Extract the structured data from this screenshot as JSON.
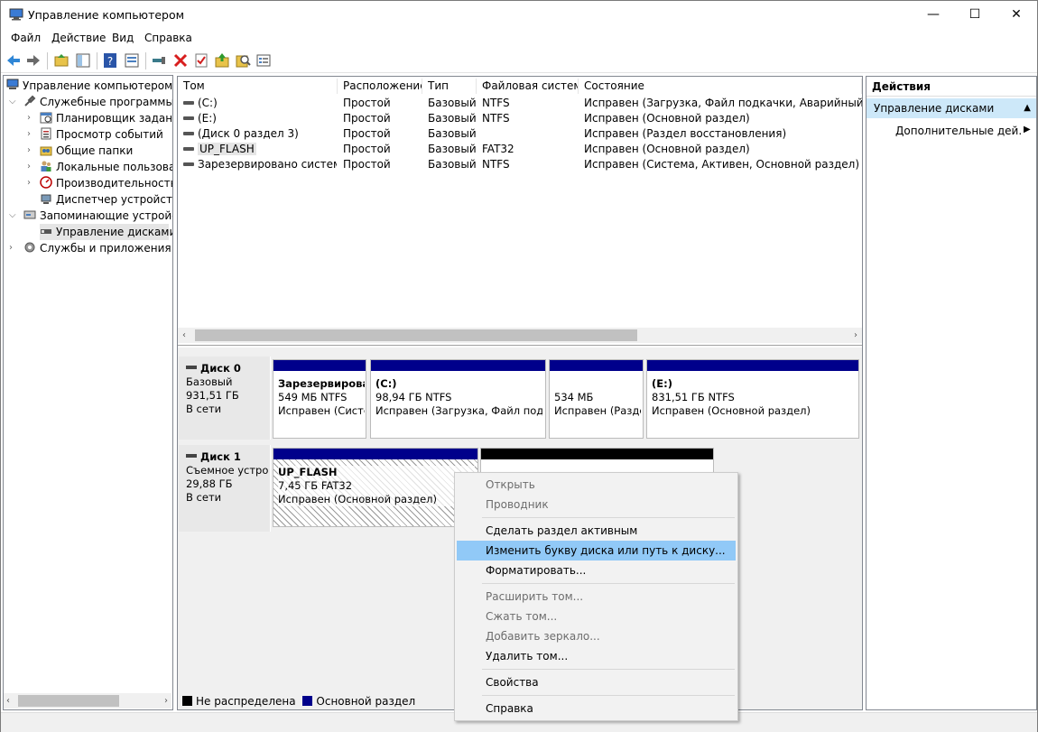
{
  "window": {
    "title": "Управление компьютером",
    "controls": {
      "minimize": "—",
      "maximize": "☐",
      "close": "✕"
    }
  },
  "menu": [
    "Файл",
    "Действие",
    "Вид",
    "Справка"
  ],
  "toolbar_icons": [
    "back-arrow-icon",
    "forward-arrow-icon",
    "up-folder-icon",
    "show-hide-tree-icon",
    "help-icon",
    "properties-view-icon",
    "connect-icon",
    "delete-icon",
    "check-icon",
    "export-icon",
    "search-icon",
    "list-icon"
  ],
  "tree": {
    "root": "Управление компьютером (л",
    "items": [
      {
        "label": "Служебные программы"
      },
      {
        "label": "Планировщик заданий"
      },
      {
        "label": "Просмотр событий"
      },
      {
        "label": "Общие папки"
      },
      {
        "label": "Локальные пользовате"
      },
      {
        "label": "Производительность"
      },
      {
        "label": "Диспетчер устройств"
      },
      {
        "label": "Запоминающие устройст"
      },
      {
        "label": "Управление дисками"
      },
      {
        "label": "Службы и приложения"
      }
    ]
  },
  "volumes": {
    "columns": [
      "Том",
      "Расположение",
      "Тип",
      "Файловая система",
      "Состояние"
    ],
    "rows": [
      [
        "(C:)",
        "Простой",
        "Базовый",
        "NTFS",
        "Исправен (Загрузка, Файл подкачки, Аварийный дамп п"
      ],
      [
        "(E:)",
        "Простой",
        "Базовый",
        "NTFS",
        "Исправен (Основной раздел)"
      ],
      [
        "(Диск 0 раздел 3)",
        "Простой",
        "Базовый",
        "",
        "Исправен (Раздел восстановления)"
      ],
      [
        "UP_FLASH",
        "Простой",
        "Базовый",
        "FAT32",
        "Исправен (Основной раздел)"
      ],
      [
        "Зарезервировано системой",
        "Простой",
        "Базовый",
        "NTFS",
        "Исправен (Система, Активен, Основной раздел)"
      ]
    ]
  },
  "disks": [
    {
      "name": "Диск 0",
      "type": "Базовый",
      "size": "931,51 ГБ",
      "status": "В сети",
      "partitions": [
        {
          "title": "Зарезервирова",
          "info": "549 МБ NTFS",
          "state": "Исправен (Систе"
        },
        {
          "title": "(C:)",
          "info": "98,94 ГБ NTFS",
          "state": "Исправен (Загрузка, Файл подкач"
        },
        {
          "title": "",
          "info": "534 МБ",
          "state": "Исправен (Разде"
        },
        {
          "title": "(E:)",
          "info": "831,51 ГБ NTFS",
          "state": "Исправен (Основной раздел)"
        }
      ]
    },
    {
      "name": "Диск 1",
      "type": "Съемное устро",
      "size": "29,88 ГБ",
      "status": "В сети",
      "partitions": [
        {
          "title": "UP_FLASH",
          "info": "7,45 ГБ FAT32",
          "state": "Исправен (Основной раздел)"
        }
      ]
    }
  ],
  "legend": {
    "unallocated": "Не распределена",
    "primary": "Основной раздел"
  },
  "actions": {
    "header": "Действия",
    "section": "Управление дисками",
    "more": "Дополнительные дей..."
  },
  "context_menu": [
    {
      "label": "Открыть",
      "enabled": false
    },
    {
      "label": "Проводник",
      "enabled": false
    },
    {
      "label": "Сделать раздел активным",
      "enabled": true
    },
    {
      "label": "Изменить букву диска или путь к диску...",
      "enabled": true,
      "highlighted": true
    },
    {
      "label": "Форматировать...",
      "enabled": true
    },
    {
      "label": "Расширить том...",
      "enabled": false
    },
    {
      "label": "Сжать том...",
      "enabled": false
    },
    {
      "label": "Добавить зеркало...",
      "enabled": false
    },
    {
      "label": "Удалить том...",
      "enabled": true
    },
    {
      "label": "Свойства",
      "enabled": true
    },
    {
      "label": "Справка",
      "enabled": true
    }
  ],
  "colors": {
    "primary_partition": "#00008b",
    "unallocated": "#000000",
    "selection": "#91c9f7",
    "actions_section": "#cde8f9"
  }
}
